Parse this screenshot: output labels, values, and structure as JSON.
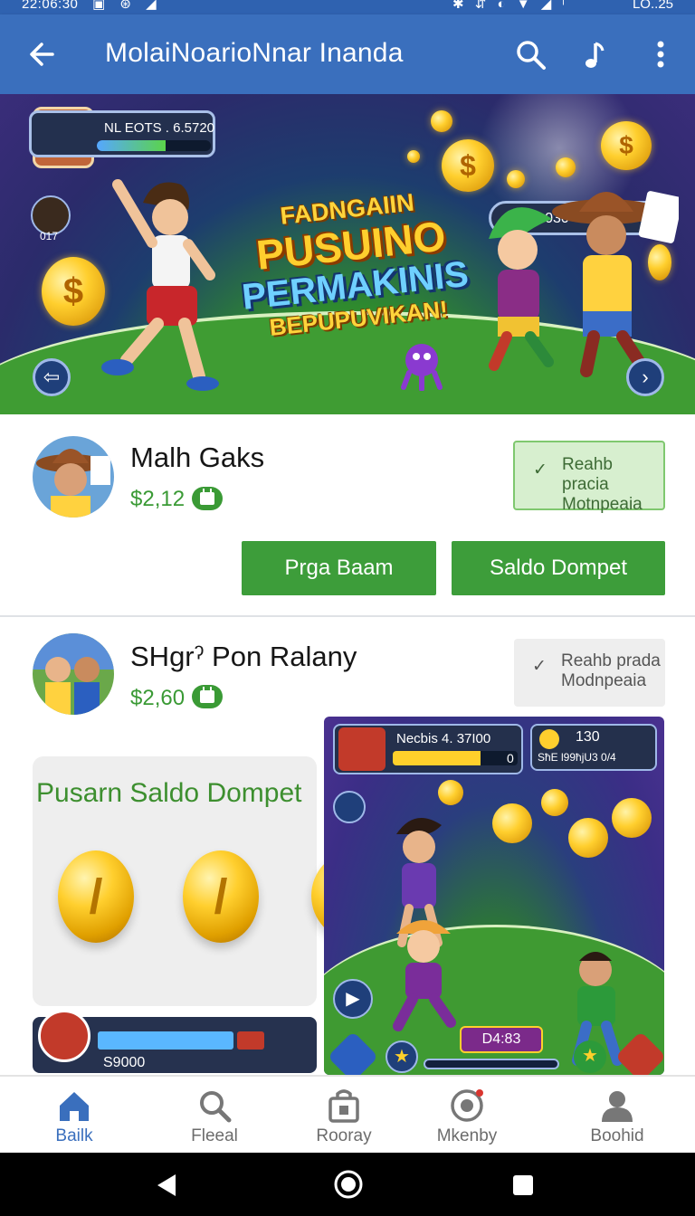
{
  "status_bar": {
    "time": "22:06:30",
    "status_icons": "▣ ⊛ ◢",
    "sys_icons": "✱ ⇵ ◐ ▼ ◢ ᶦ",
    "battery": "LO..25"
  },
  "app_bar": {
    "title": "MolaiNoarioNnar Inanda",
    "back_icon": "arrow-left-icon",
    "search_icon": "search-icon",
    "music_icon": "music-note-icon",
    "more_icon": "more-vert-icon"
  },
  "hero": {
    "headline_1": "FADNGAIIN",
    "headline_2": "PUSUINO",
    "headline_3": "PERMAKINIS",
    "headline_4": "BEPUPUVIKAN!",
    "hud_left_label": "NL EOTS .   6.5720",
    "hud_left_level": 0.6,
    "hud_left_badge": "017",
    "hud_right_label": "S:030"
  },
  "item1": {
    "name": "Malh Gaks",
    "price": "$2,12",
    "status_line1": "Reahb pracia",
    "status_line2": "Motnpeaia",
    "button1": "Prga Baam",
    "button2": "Saldo Dompet"
  },
  "item2": {
    "name": "SHgrˀ Pon Ralany",
    "price": "$2,60",
    "status_line1": "Reahb prada",
    "status_line2": "Modnpeaia",
    "promo_title": "Pusarn Saldo Dompet",
    "mini_hud_value": "S9000",
    "game_hud_label": "Necbis   4. 37I00",
    "game_hud_value": "0",
    "game_hud_level": 0.7,
    "game_hud_coins": "130",
    "game_hud_sub": "SħE l99ħjU3 0/4",
    "game_pill": "D4:83"
  },
  "bottom_nav": [
    {
      "label": "Bailk",
      "icon": "home-icon",
      "active": true
    },
    {
      "label": "Fleeal",
      "icon": "search-icon",
      "active": false
    },
    {
      "label": "Rooray",
      "icon": "shop-icon",
      "active": false
    },
    {
      "label": "Mkenby",
      "icon": "settings-badge-icon",
      "active": false
    },
    {
      "label": "Boohid",
      "icon": "profile-icon",
      "active": false
    }
  ],
  "colors": {
    "app_bar": "#3a6fbd",
    "accent_green": "#3d9d3a",
    "price_green": "#3a9a35"
  }
}
